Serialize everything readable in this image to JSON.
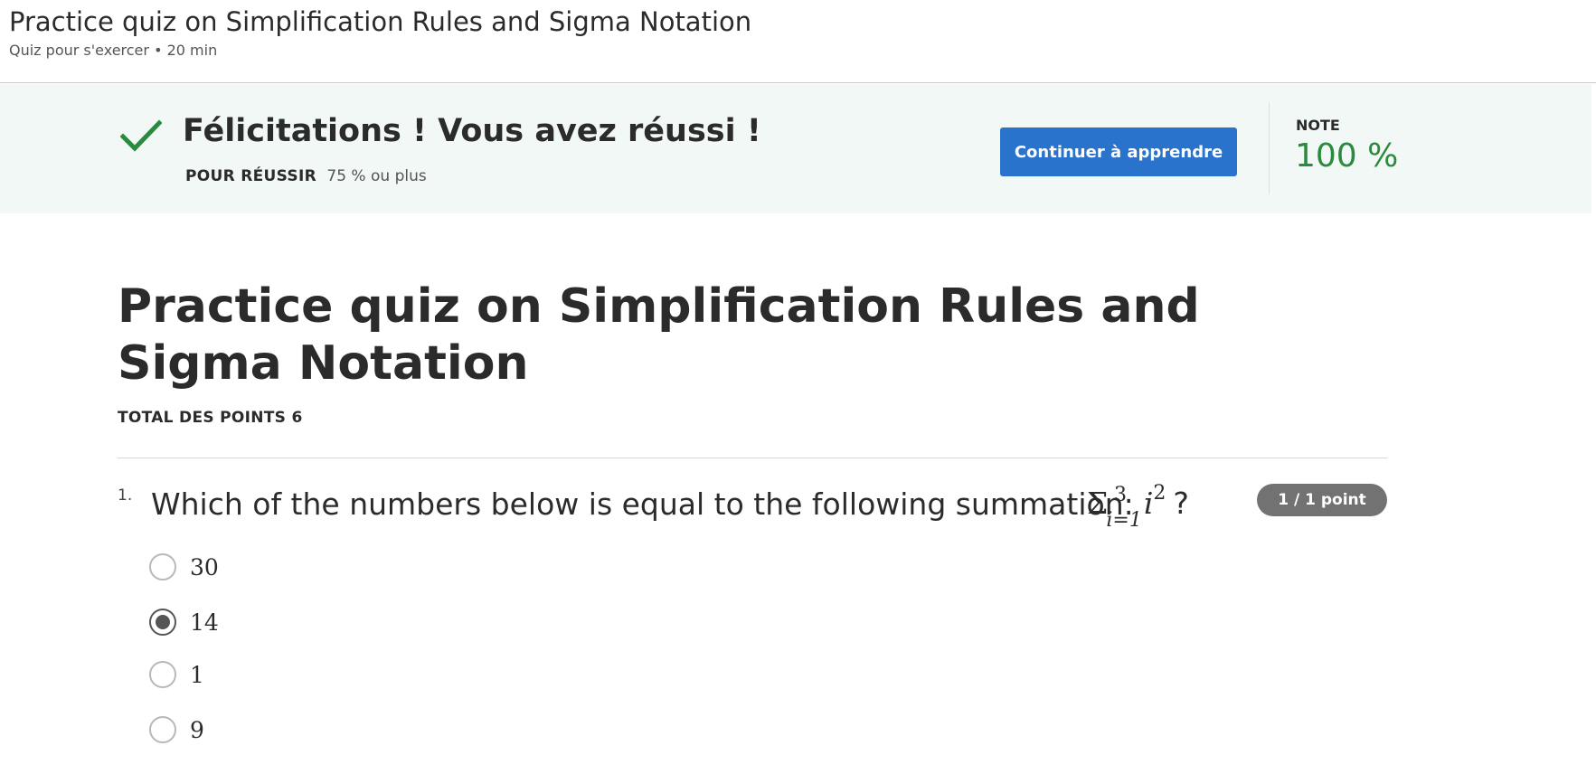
{
  "header": {
    "title": "Practice quiz on Simplification Rules and Sigma Notation",
    "subtitle": "Quiz pour s'exercer • 20 min"
  },
  "banner": {
    "heading": "Félicitations ! Vous avez réussi !",
    "pass_label": "POUR RÉUSSIR",
    "pass_value": "75 % ou plus",
    "continue_label": "Continuer à apprendre",
    "grade_label": "NOTE",
    "grade_value": "100 %",
    "icon": "checkmark-icon",
    "success_color": "#2b8a3e",
    "button_color": "#2a73cc"
  },
  "main": {
    "title": "Practice quiz on Simplification Rules and Sigma Notation",
    "total_points": "TOTAL DES POINTS 6"
  },
  "questions": [
    {
      "number": "1.",
      "text": "Which of the numbers below is equal to the following summation:",
      "math": {
        "symbol": "Σ",
        "upper": "3",
        "lower": "i=1",
        "variable": "i",
        "exponent": "2",
        "suffix": "?"
      },
      "points": "1 / 1 point",
      "options": [
        {
          "label": "30",
          "selected": false
        },
        {
          "label": "14",
          "selected": true
        },
        {
          "label": "1",
          "selected": false
        },
        {
          "label": "9",
          "selected": false
        }
      ]
    }
  ]
}
